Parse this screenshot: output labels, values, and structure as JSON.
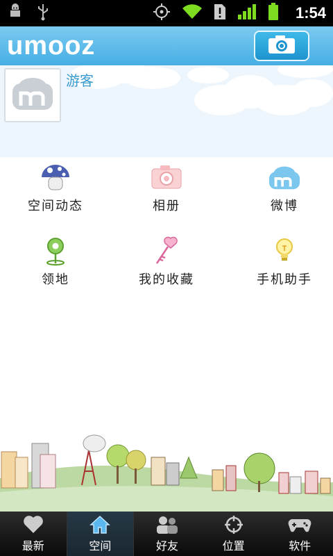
{
  "status_bar": {
    "time": "1:54"
  },
  "header": {
    "logo_text": "umooz"
  },
  "profile": {
    "username": "游客"
  },
  "grid": [
    {
      "label": "空间动态",
      "icon": "mushroom-icon"
    },
    {
      "label": "相册",
      "icon": "camera-icon"
    },
    {
      "label": "微博",
      "icon": "cloud-icon"
    },
    {
      "label": "领地",
      "icon": "location-pin-icon"
    },
    {
      "label": "我的收藏",
      "icon": "heart-key-icon"
    },
    {
      "label": "手机助手",
      "icon": "lightbulb-icon"
    }
  ],
  "tabs": [
    {
      "label": "最新",
      "icon": "heart-icon",
      "active": false
    },
    {
      "label": "空间",
      "icon": "home-icon",
      "active": true
    },
    {
      "label": "好友",
      "icon": "friends-icon",
      "active": false
    },
    {
      "label": "位置",
      "icon": "crosshair-icon",
      "active": false
    },
    {
      "label": "软件",
      "icon": "gamepad-icon",
      "active": false
    }
  ],
  "colors": {
    "header": "#46aee4",
    "username": "#3a9bd0",
    "tab_bar": "#0a0a0a"
  }
}
